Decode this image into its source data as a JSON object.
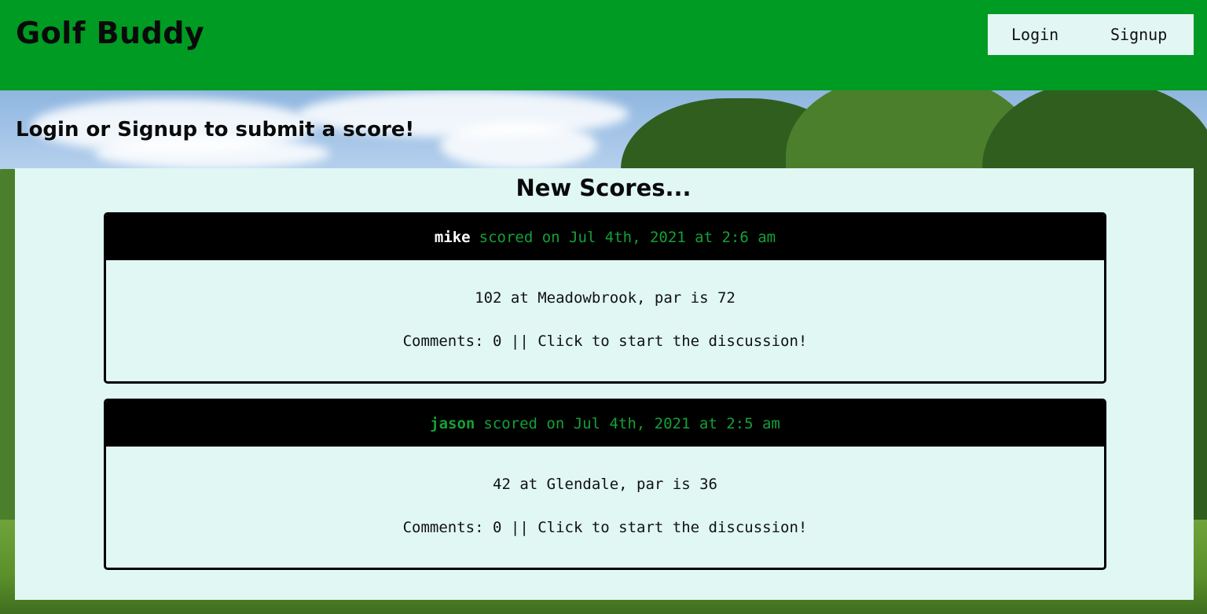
{
  "header": {
    "brand": "Golf Buddy",
    "nav": {
      "login_label": "Login",
      "signup_label": "Signup"
    }
  },
  "prompt": "Login or Signup to submit a score!",
  "scores": {
    "title": "New Scores...",
    "items": [
      {
        "user": "mike",
        "timestamp_text": "scored on Jul 4th, 2021 at 2:6 am",
        "score_text": "102 at Meadowbrook, par is 72",
        "comments_text": "Comments: 0 || Click to start the discussion!"
      },
      {
        "user": "jason",
        "timestamp_text": "scored on Jul 4th, 2021 at 2:5 am",
        "score_text": "42 at Glendale, par is 36",
        "comments_text": "Comments: 0 || Click to start the discussion!"
      }
    ]
  },
  "colors": {
    "header_bg": "#009b22",
    "panel_bg": "#e0f7f4",
    "accent_green": "#14a037",
    "card_header_bg": "#000000"
  }
}
